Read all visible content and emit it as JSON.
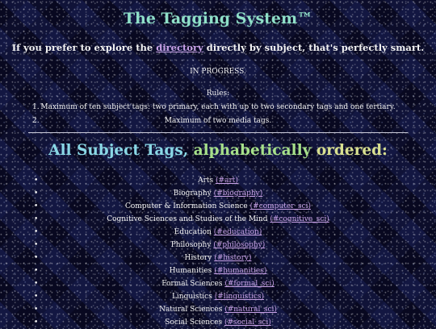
{
  "page": {
    "title": "The Tagging System™",
    "subtitle_before": "If you prefer to explore the ",
    "subtitle_link": "directory",
    "subtitle_after": " directly by subject, that's perfectly smart.",
    "progress": "IN PROGRESS.",
    "rules_label": "Rules:",
    "rules": [
      {
        "num": "1.",
        "text": "Maximum of ten subject tags: two primary, each with up to two secondary tags and one tertiary."
      },
      {
        "num": "2.",
        "text": "Maximum of two media tags."
      }
    ],
    "heading_parts": [
      "All Subject Tags, ",
      "alphabetically ",
      "ordered:"
    ],
    "tags": [
      {
        "name": "Arts",
        "tag": "(#art)"
      },
      {
        "name": "Biography",
        "tag": "(#biography)"
      },
      {
        "name": "Computer & Information Science",
        "tag": "(#computer_sci)"
      },
      {
        "name": "Cognitive Sciences and Studies of the Mind",
        "tag": "(#cognitive_sci)"
      },
      {
        "name": "Education",
        "tag": "(#education)"
      },
      {
        "name": "Philosophy",
        "tag": "(#philosophy)"
      },
      {
        "name": "History",
        "tag": "(#history)"
      },
      {
        "name": "Humanities",
        "tag": "(#humanities)"
      },
      {
        "name": "Formal Sciences",
        "tag": "(#formal_sci)"
      },
      {
        "name": "Linguistics",
        "tag": "(#linguistics)"
      },
      {
        "name": "Natural Sciences",
        "tag": "(#natural_sci)"
      },
      {
        "name": "Social Sciences",
        "tag": "(#social_sci)"
      }
    ],
    "bullet": "•"
  }
}
